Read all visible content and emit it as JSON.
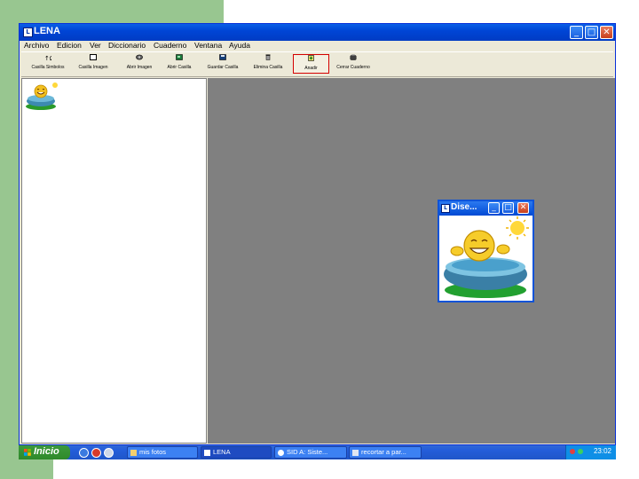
{
  "window": {
    "title": "LENA",
    "app_icon_glyph": "L",
    "controls": {
      "minimize": "_",
      "maximize": "□",
      "close": "✕"
    }
  },
  "menu": [
    "Archivo",
    "Edicion",
    "Ver",
    "Diccionario",
    "Cuaderno",
    "Ventana",
    "Ayuda"
  ],
  "toolbar": {
    "tools": [
      {
        "label": "Casilla Simbolos",
        "icon": "symbol-cell-icon"
      },
      {
        "label": "Casilla Imagen",
        "icon": "image-cell-icon"
      },
      {
        "label": "Abrir Imagen",
        "icon": "open-image-icon"
      },
      {
        "label": "Abrir Casilla",
        "icon": "open-cell-icon"
      },
      {
        "label": "Guardar Casilla",
        "icon": "save-cell-icon"
      },
      {
        "label": "Elimina Casilla",
        "icon": "delete-cell-icon"
      },
      {
        "label": "Anadir",
        "icon": "add-icon",
        "active": true
      },
      {
        "label": "Cerrar Cuaderno",
        "icon": "close-notebook-icon"
      }
    ]
  },
  "child_window": {
    "title": "Dise...",
    "app_icon_glyph": "L",
    "controls": {
      "minimize": "_",
      "maximize": "□",
      "close": "✕"
    }
  },
  "taskbar": {
    "start_label": "Inicio",
    "tasks": [
      {
        "label": "mis fotos",
        "active": false
      },
      {
        "label": "LENA",
        "active": true
      },
      {
        "label": "SID A: Siste...",
        "active": false
      },
      {
        "label": "recortar a par...",
        "active": false
      }
    ],
    "clock": "23:02"
  },
  "colors": {
    "slide_green": "#98c690",
    "titlebar_blue": "#0045d6",
    "mdi_gray": "#808080",
    "taskbar_blue": "#245edb",
    "start_green": "#3c9a3c"
  }
}
